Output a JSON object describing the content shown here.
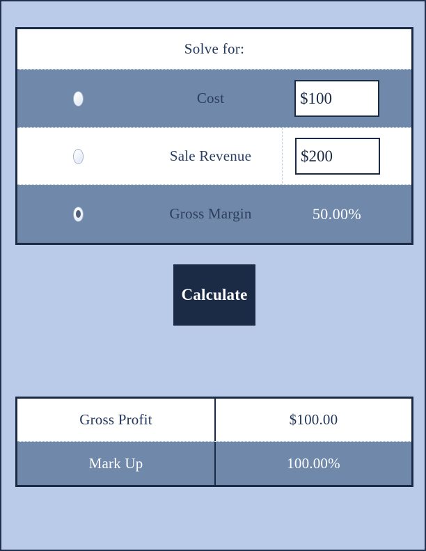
{
  "page": {
    "background_color": "#b9cbe8",
    "accent_navy": "#1b2b45",
    "row_shade": "#7088aa"
  },
  "solve_panel": {
    "header": "Solve for:",
    "rows": [
      {
        "label": "Cost",
        "value": "$100",
        "input_type": "text",
        "selected": false,
        "radio_name": "radio-cost"
      },
      {
        "label": "Sale Revenue",
        "value": "$200",
        "input_type": "text",
        "selected": false,
        "radio_name": "radio-sale-revenue"
      },
      {
        "label": "Gross Margin",
        "value": "50.00%",
        "input_type": "readonly",
        "selected": true,
        "radio_name": "radio-gross-margin"
      }
    ]
  },
  "calculate": {
    "label": "Calculate"
  },
  "results_panel": {
    "rows": [
      {
        "name": "Gross Profit",
        "value": "$100.00"
      },
      {
        "name": "Mark Up",
        "value": "100.00%"
      }
    ]
  }
}
